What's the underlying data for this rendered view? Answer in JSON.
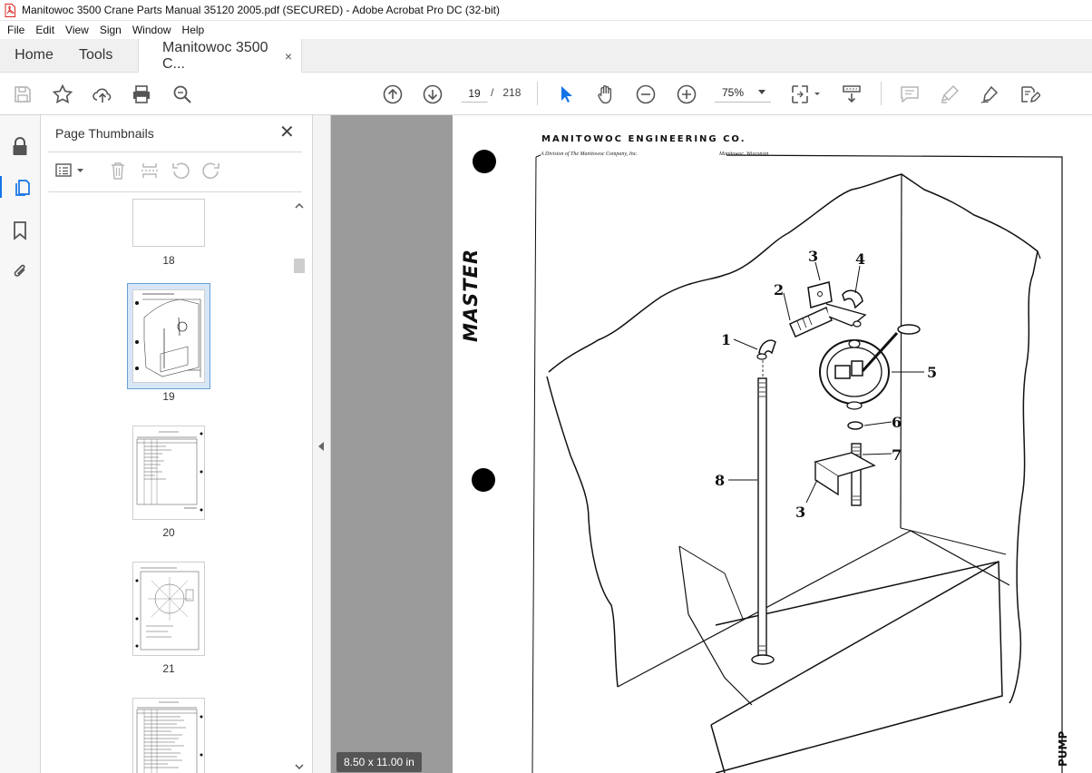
{
  "window": {
    "title": "Manitowoc 3500 Crane Parts Manual 35120 2005.pdf (SECURED) - Adobe Acrobat Pro DC (32-bit)"
  },
  "menu": [
    "File",
    "Edit",
    "View",
    "Sign",
    "Window",
    "Help"
  ],
  "tabs": {
    "home": "Home",
    "tools": "Tools",
    "document": "Manitowoc 3500 C...",
    "close": "×"
  },
  "toolbar": {
    "current_page": "19",
    "page_separator": "/",
    "total_pages": "218",
    "zoom": "75%"
  },
  "thumbnails_panel": {
    "title": "Page Thumbnails",
    "close": "✕",
    "pages": [
      {
        "label": "18",
        "selected": false
      },
      {
        "label": "19",
        "selected": true
      },
      {
        "label": "20",
        "selected": false
      },
      {
        "label": "21",
        "selected": false
      }
    ]
  },
  "document_page": {
    "company_name": "MANITOWOC ENGINEERING CO.",
    "division_text": "A Division of The Manitowoc Company, Inc.",
    "location_text": "Manitowoc, Wisconsin",
    "side_label": "MASTER",
    "section_label": "PUMP",
    "callouts": [
      "1",
      "2",
      "3",
      "4",
      "5",
      "6",
      "7",
      "8",
      "3"
    ]
  },
  "status": {
    "page_size": "8.50 x 11.00 in"
  },
  "colors": {
    "accent_blue": "#1473e6",
    "workspace_gray": "#9b9b9b",
    "pdf_icon_red": "#d9251c"
  }
}
